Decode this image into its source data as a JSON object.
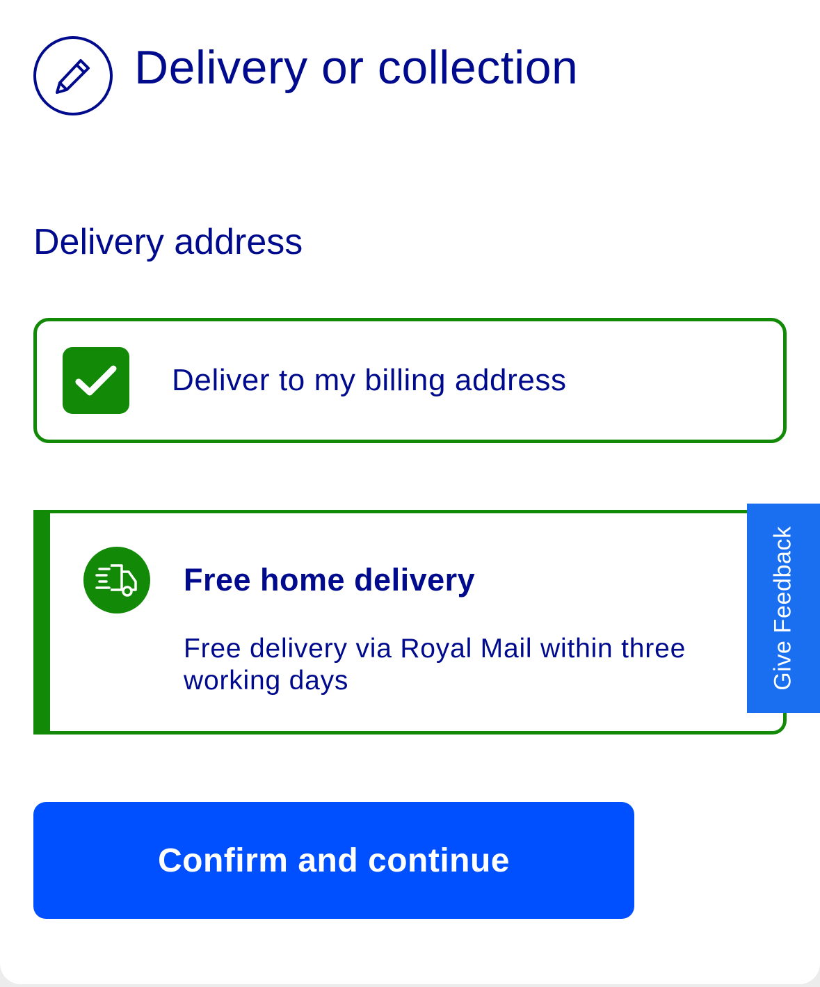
{
  "header": {
    "icon": "pencil-icon",
    "title": "Delivery or collection"
  },
  "delivery_address": {
    "heading": "Delivery address",
    "billing_option": {
      "label": "Deliver to my billing address",
      "checked": true,
      "icon": "checkmark-icon"
    }
  },
  "delivery_method": {
    "icon": "delivery-truck-icon",
    "title": "Free home delivery",
    "description": "Free delivery via Royal Mail within three working days"
  },
  "feedback": {
    "label": "Give Feedback"
  },
  "actions": {
    "confirm_label": "Confirm and continue"
  },
  "colors": {
    "brand_text": "#000a8c",
    "success_green": "#138a07",
    "primary_button": "#0050ff",
    "feedback_tab": "#1a6ff0"
  }
}
